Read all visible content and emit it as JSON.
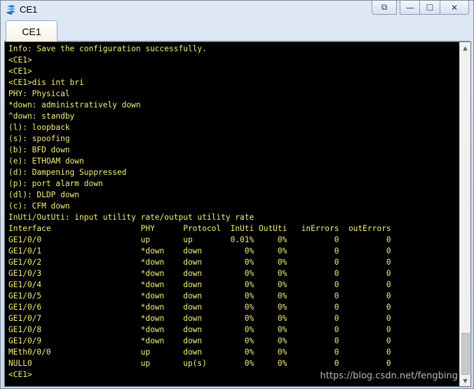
{
  "window": {
    "title": "CE1",
    "controls": {
      "restore": "⧉",
      "minimize": "—",
      "maximize": "☐",
      "close": "✕"
    }
  },
  "tabs": [
    {
      "label": "CE1",
      "active": true
    }
  ],
  "terminal": {
    "text_color": "#f1ee7c",
    "background": "#000000",
    "lines": [
      "Info: Save the configuration successfully.",
      "<CE1>",
      "<CE1>",
      "<CE1>dis int bri",
      "PHY: Physical",
      "*down: administratively down",
      "^down: standby",
      "(l): loopback",
      "(s): spoofing",
      "(b): BFD down",
      "(e): ETHOAM down",
      "(d): Dampening Suppressed",
      "(p): port alarm down",
      "(dl): DLDP down",
      "(c): CFM down",
      "InUti/OutUti: input utility rate/output utility rate",
      "Interface                   PHY      Protocol  InUti OutUti   inErrors  outErrors",
      "GE1/0/0                     up       up        0.01%     0%          0          0",
      "GE1/0/1                     *down    down         0%     0%          0          0",
      "GE1/0/2                     *down    down         0%     0%          0          0",
      "GE1/0/3                     *down    down         0%     0%          0          0",
      "GE1/0/4                     *down    down         0%     0%          0          0",
      "GE1/0/5                     *down    down         0%     0%          0          0",
      "GE1/0/6                     *down    down         0%     0%          0          0",
      "GE1/0/7                     *down    down         0%     0%          0          0",
      "GE1/0/8                     *down    down         0%     0%          0          0",
      "GE1/0/9                     *down    down         0%     0%          0          0",
      "MEth0/0/0                   up       down         0%     0%          0          0",
      "NULL0                       up       up(s)        0%     0%          0          0",
      "<CE1>"
    ]
  },
  "watermark": "https://blog.csdn.net/fengbing",
  "scrollbar": {
    "up_icon": "▲",
    "down_icon": "▼"
  }
}
